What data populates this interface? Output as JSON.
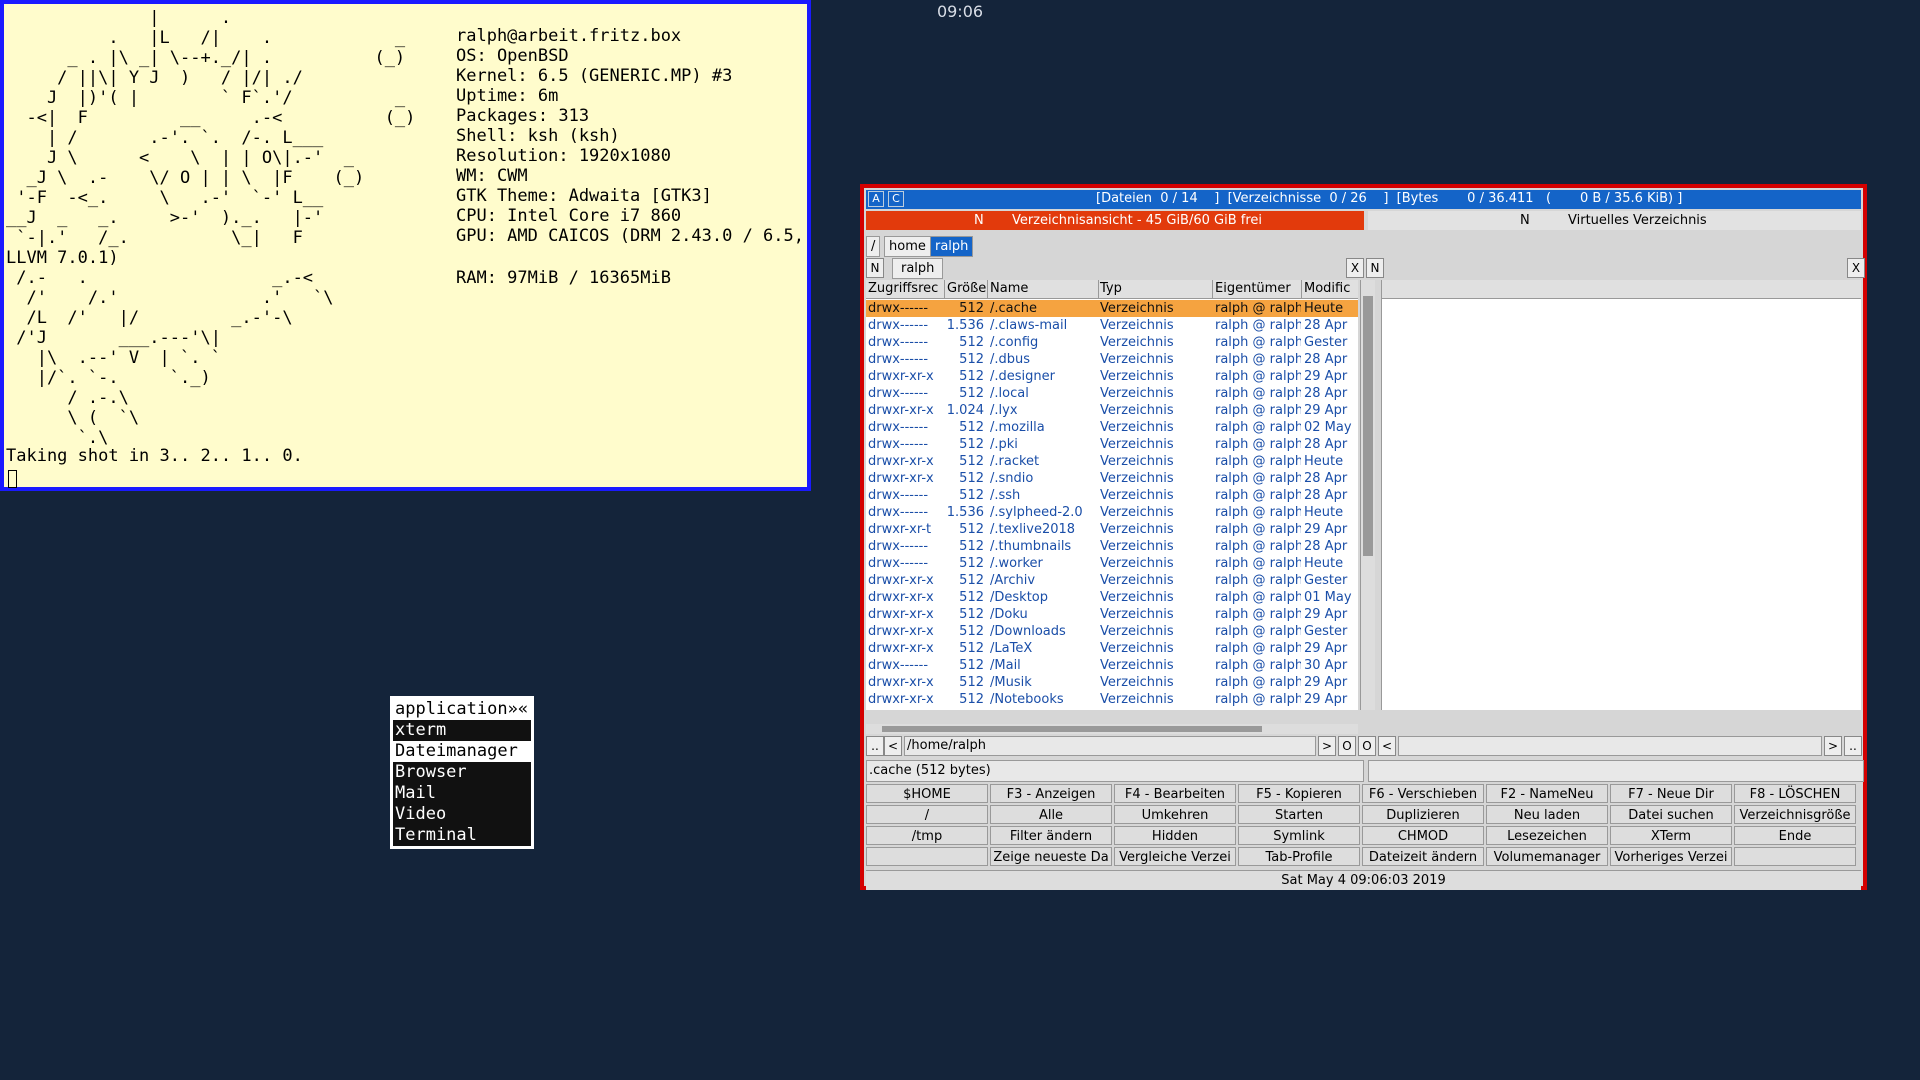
{
  "clock": "09:06",
  "xterm": {
    "art": "              |      .\n          .   |L   /|    .            _\n      _ . |\\ _| \\--+._/| .          (_)\n     / ||\\| Y J  )   / |/| ./\n    J  |)'( |        ` F`.'/          _\n  -<|  F         __     .-<          (_)\n    | /       .-'. `.  /-. L___\n    J \\      <    \\  | | O\\|.-'  _\n  _J \\  .-    \\/ O | | \\  |F    (_)\n '-F  -<_.     \\   .-'  `-' L__\n__J  _   _.     >-'  )._.   |-'\n `-|.'   /_.          \\_|   F",
    "info": "ralph@arbeit.fritz.box\nOS: OpenBSD\nKernel: 6.5 (GENERIC.MP) #3\nUptime: 6m\nPackages: 313\nShell: ksh (ksh)\nResolution: 1920x1080\nWM: CWM\nGTK Theme: Adwaita [GTK3]\nCPU: Intel Core i7 860\nGPU: AMD CAICOS (DRM 2.43.0 / 6.5,",
    "llvm": "LLVM 7.0.1)\n /.-   .                  _.-<\n  /'    /.'              .'   `\\\n  /L  /'   |/         _.-'-\\\n /'J       ___.---'\\|\n   |\\  .--' V  | `. `\n   |/`. `-.     `._)\n      / .-.\\\n      \\ (  `\\\n       `.\\",
    "ram": "RAM: 97MiB / 16365MiB",
    "shot": "Taking shot in 3.. 2.. 1.. 0."
  },
  "appmenu": {
    "title": "application»«",
    "items": [
      "xterm",
      "Dateimanager",
      "Browser",
      "Mail",
      "Video",
      "Terminal"
    ]
  },
  "worker": {
    "top": {
      "a": "A",
      "c": "C",
      "stats": "[Dateien  0 / 14    ]  [Verzeichnisse  0 / 26    ]  [Bytes       0 / 36.411   (       0 B / 35.6 KiB) ]"
    },
    "left_title": {
      "n": "N",
      "text": "Verzeichnisansicht - 45 GiB/60 GiB frei"
    },
    "right_title": {
      "n": "N",
      "text": "Virtuelles Verzeichnis"
    },
    "crumbs": [
      "/",
      "home",
      "ralph"
    ],
    "left_tab": {
      "n": "N",
      "label": "ralph",
      "x": "X"
    },
    "right_tab": {
      "n": "N",
      "x": "X"
    },
    "columns": [
      "Zugriffsrec",
      "Größe",
      "Name",
      "Typ",
      "Eigentümer",
      "Modific"
    ],
    "rows": [
      [
        "drwx------",
        "512",
        "/.cache",
        "Verzeichnis",
        "ralph @ ralph",
        "Heute"
      ],
      [
        "drwx------",
        "1.536",
        "/.claws-mail",
        "Verzeichnis",
        "ralph @ ralph",
        "28 Apr"
      ],
      [
        "drwx------",
        "512",
        "/.config",
        "Verzeichnis",
        "ralph @ ralph",
        "Gester"
      ],
      [
        "drwx------",
        "512",
        "/.dbus",
        "Verzeichnis",
        "ralph @ ralph",
        "28 Apr"
      ],
      [
        "drwxr-xr-x",
        "512",
        "/.designer",
        "Verzeichnis",
        "ralph @ ralph",
        "29 Apr"
      ],
      [
        "drwx------",
        "512",
        "/.local",
        "Verzeichnis",
        "ralph @ ralph",
        "28 Apr"
      ],
      [
        "drwxr-xr-x",
        "1.024",
        "/.lyx",
        "Verzeichnis",
        "ralph @ ralph",
        "29 Apr"
      ],
      [
        "drwx------",
        "512",
        "/.mozilla",
        "Verzeichnis",
        "ralph @ ralph",
        "02 May"
      ],
      [
        "drwx------",
        "512",
        "/.pki",
        "Verzeichnis",
        "ralph @ ralph",
        "28 Apr"
      ],
      [
        "drwxr-xr-x",
        "512",
        "/.racket",
        "Verzeichnis",
        "ralph @ ralph",
        "Heute"
      ],
      [
        "drwxr-xr-x",
        "512",
        "/.sndio",
        "Verzeichnis",
        "ralph @ ralph",
        "28 Apr"
      ],
      [
        "drwx------",
        "512",
        "/.ssh",
        "Verzeichnis",
        "ralph @ ralph",
        "28 Apr"
      ],
      [
        "drwx------",
        "1.536",
        "/.sylpheed-2.0",
        "Verzeichnis",
        "ralph @ ralph",
        "Heute"
      ],
      [
        "drwxr-xr-t",
        "512",
        "/.texlive2018",
        "Verzeichnis",
        "ralph @ ralph",
        "29 Apr"
      ],
      [
        "drwx------",
        "512",
        "/.thumbnails",
        "Verzeichnis",
        "ralph @ ralph",
        "28 Apr"
      ],
      [
        "drwx------",
        "512",
        "/.worker",
        "Verzeichnis",
        "ralph @ ralph",
        "Heute"
      ],
      [
        "drwxr-xr-x",
        "512",
        "/Archiv",
        "Verzeichnis",
        "ralph @ ralph",
        "Gester"
      ],
      [
        "drwxr-xr-x",
        "512",
        "/Desktop",
        "Verzeichnis",
        "ralph @ ralph",
        "01 May"
      ],
      [
        "drwxr-xr-x",
        "512",
        "/Doku",
        "Verzeichnis",
        "ralph @ ralph",
        "29 Apr"
      ],
      [
        "drwxr-xr-x",
        "512",
        "/Downloads",
        "Verzeichnis",
        "ralph @ ralph",
        "Gester"
      ],
      [
        "drwxr-xr-x",
        "512",
        "/LaTeX",
        "Verzeichnis",
        "ralph @ ralph",
        "29 Apr"
      ],
      [
        "drwx------",
        "512",
        "/Mail",
        "Verzeichnis",
        "ralph @ ralph",
        "30 Apr"
      ],
      [
        "drwxr-xr-x",
        "512",
        "/Musik",
        "Verzeichnis",
        "ralph @ ralph",
        "29 Apr"
      ],
      [
        "drwxr-xr-x",
        "512",
        "/Notebooks",
        "Verzeichnis",
        "ralph @ ralph",
        "29 Apr"
      ]
    ],
    "path_left": "/home/ralph",
    "path_right": "",
    "path_buttons": {
      "dotdot": "..",
      "lt": "<",
      "gt": ">",
      "o": "O"
    },
    "status_left": ".cache  (512 bytes)",
    "fkeys": [
      [
        "$HOME",
        "F3 - Anzeigen",
        "F4 - Bearbeiten",
        "F5 - Kopieren",
        "F6 - Verschieben",
        "F2 - NameNeu",
        "F7 - Neue Dir",
        "F8 - LÖSCHEN"
      ],
      [
        "/",
        "Alle",
        "Umkehren",
        "Starten",
        "Duplizieren",
        "Neu laden",
        "Datei suchen",
        "Verzeichnisgröße"
      ],
      [
        "/tmp",
        "Filter ändern",
        "Hidden",
        "Symlink",
        "CHMOD",
        "Lesezeichen",
        "XTerm",
        "Ende"
      ],
      [
        "",
        "Zeige neueste Da",
        "Vergleiche Verzei",
        "Tab-Profile",
        "Dateizeit ändern",
        "Volumemanager",
        "Vorheriges Verzei",
        ""
      ]
    ],
    "date": "Sat May  4 09:06:03 2019"
  },
  "colors": {
    "desktop": "#14243a",
    "xterm_bg": "#fffccc",
    "xterm_border": "#1a1aff",
    "worker_border": "#d40000",
    "active_title": "#e23a0c",
    "accent_blue": "#1464c8",
    "selection": "#f5a340"
  }
}
